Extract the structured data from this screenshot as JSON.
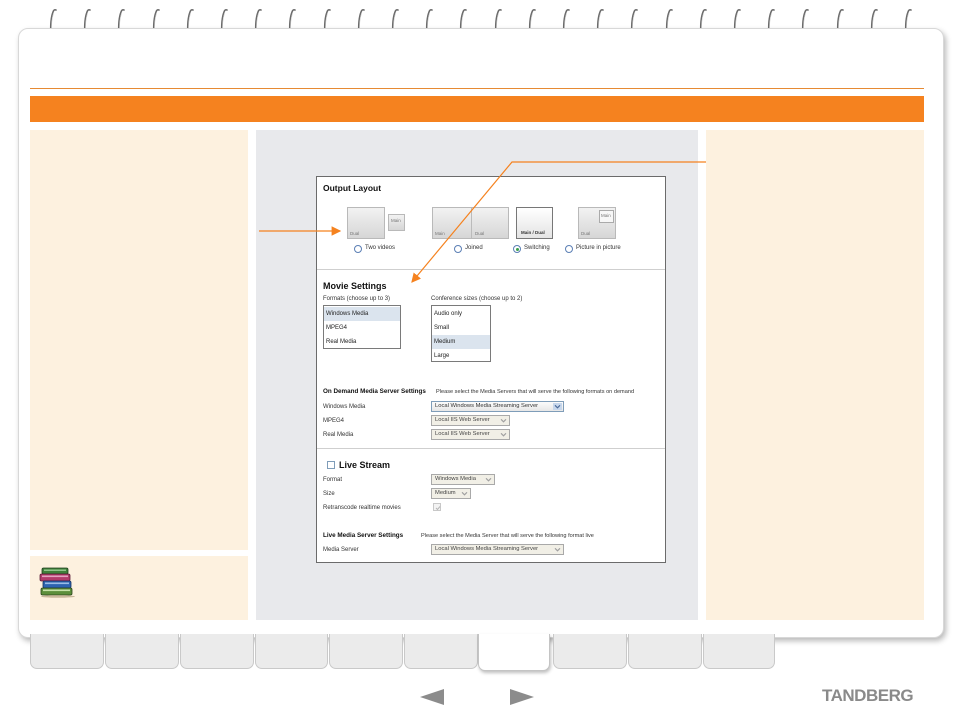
{
  "brand": {
    "name": "TANDBERG"
  },
  "colors": {
    "accent": "#f5821f",
    "panel": "#fdf1df",
    "center": "#e8e9ec",
    "link": "#1a4fa0"
  },
  "left_bottom": {
    "icon": "books-icon",
    "link_line_1": "",
    "link_line_2": ""
  },
  "output_layout": {
    "title": "Output Layout",
    "options": [
      {
        "label": "Two videos",
        "selected": false,
        "thumb_labels": [
          "Dual",
          "Main"
        ]
      },
      {
        "label": "Joined",
        "selected": false,
        "thumb_labels": [
          "Main",
          "Dual"
        ]
      },
      {
        "label": "Switching",
        "selected": true,
        "thumb_labels": [
          "Main / Dual"
        ]
      },
      {
        "label": "Picture in picture",
        "selected": false,
        "thumb_labels": [
          "Dual",
          "Main"
        ]
      }
    ]
  },
  "movie_settings": {
    "title": "Movie Settings",
    "formats_label": "Formats (choose up to 3)",
    "formats": [
      {
        "label": "Windows Media",
        "selected": true
      },
      {
        "label": "MPEG4",
        "selected": false
      },
      {
        "label": "Real Media",
        "selected": false
      }
    ],
    "sizes_label": "Conference sizes (choose up to 2)",
    "sizes": [
      {
        "label": "Audio only",
        "selected": false
      },
      {
        "label": "Small",
        "selected": false
      },
      {
        "label": "Medium",
        "selected": true
      },
      {
        "label": "Large",
        "selected": false
      }
    ]
  },
  "on_demand": {
    "title": "On Demand Media Server Settings",
    "description": "Please select the Media Servers that will serve the following formats on demand",
    "rows": [
      {
        "label": "Windows Media",
        "value": "Local Windows Media Streaming Server"
      },
      {
        "label": "MPEG4",
        "value": "Local IIS Web Server"
      },
      {
        "label": "Real Media",
        "value": "Local IIS Web Server"
      }
    ]
  },
  "live_stream": {
    "title": "Live Stream",
    "checked": false,
    "format_label": "Format",
    "format_value": "Windows Media",
    "size_label": "Size",
    "size_value": "Medium",
    "retranscode_label": "Retranscode realtime movies"
  },
  "live_media": {
    "title": "Live Media Server Settings",
    "description": "Please select the Media Server that will serve the following format live",
    "server_label": "Media Server",
    "server_value": "Local Windows Media Streaming Server"
  },
  "nav": {
    "prev": "previous-page",
    "next": "next-page"
  }
}
